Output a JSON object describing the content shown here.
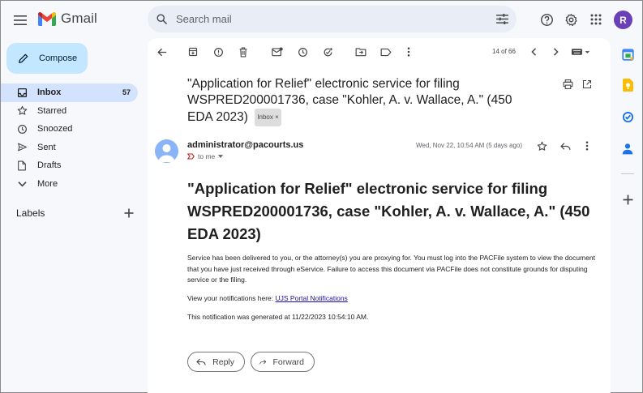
{
  "app": {
    "name": "Gmail"
  },
  "search": {
    "placeholder": "Search mail"
  },
  "account": {
    "initial": "R"
  },
  "compose": {
    "label": "Compose"
  },
  "nav": {
    "items": [
      {
        "label": "Inbox",
        "count": "57",
        "icon": "inbox-icon"
      },
      {
        "label": "Starred",
        "icon": "star-icon"
      },
      {
        "label": "Snoozed",
        "icon": "clock-icon"
      },
      {
        "label": "Sent",
        "icon": "send-icon"
      },
      {
        "label": "Drafts",
        "icon": "draft-icon"
      },
      {
        "label": "More",
        "icon": "chevron-down-icon"
      }
    ],
    "labels_heading": "Labels"
  },
  "toolbar": {
    "pager": "14 of 66"
  },
  "email": {
    "subject": "\"Application for Relief\" electronic service for filing WSPRED200001736, case \"Kohler, A. v. Wallace, A.\" (450 EDA 2023)",
    "label_chip": "Inbox",
    "label_chip_close": "×",
    "sender": "administrator@pacourts.us",
    "to": "to me",
    "date": "Wed, Nov 22, 10:54 AM (5 days ago)",
    "body_title": "\"Application for Relief\" electronic service for filing WSPRED200001736, case \"Kohler, A. v. Wallace, A.\" (450 EDA 2023)",
    "para1": "Service has been delivered to you, or the attorney(s) you are proxying for. You must log into the PACFile system to view the document that you have just received through eService. Failure to access this document via PACFile does not constitute grounds for disputing service or the filing.",
    "para2_prefix": "View your notifications here: ",
    "para2_link": "UJS Portal Notifications",
    "para3": "This notification was generated at 11/22/2023 10:54:10 AM."
  },
  "actions": {
    "reply": "Reply",
    "forward": "Forward"
  },
  "colors": {
    "accent": "#0b57d0",
    "compose_bg": "#c2e7ff",
    "active_nav": "#d3e3fd",
    "avatar": "#6a3fb7"
  }
}
